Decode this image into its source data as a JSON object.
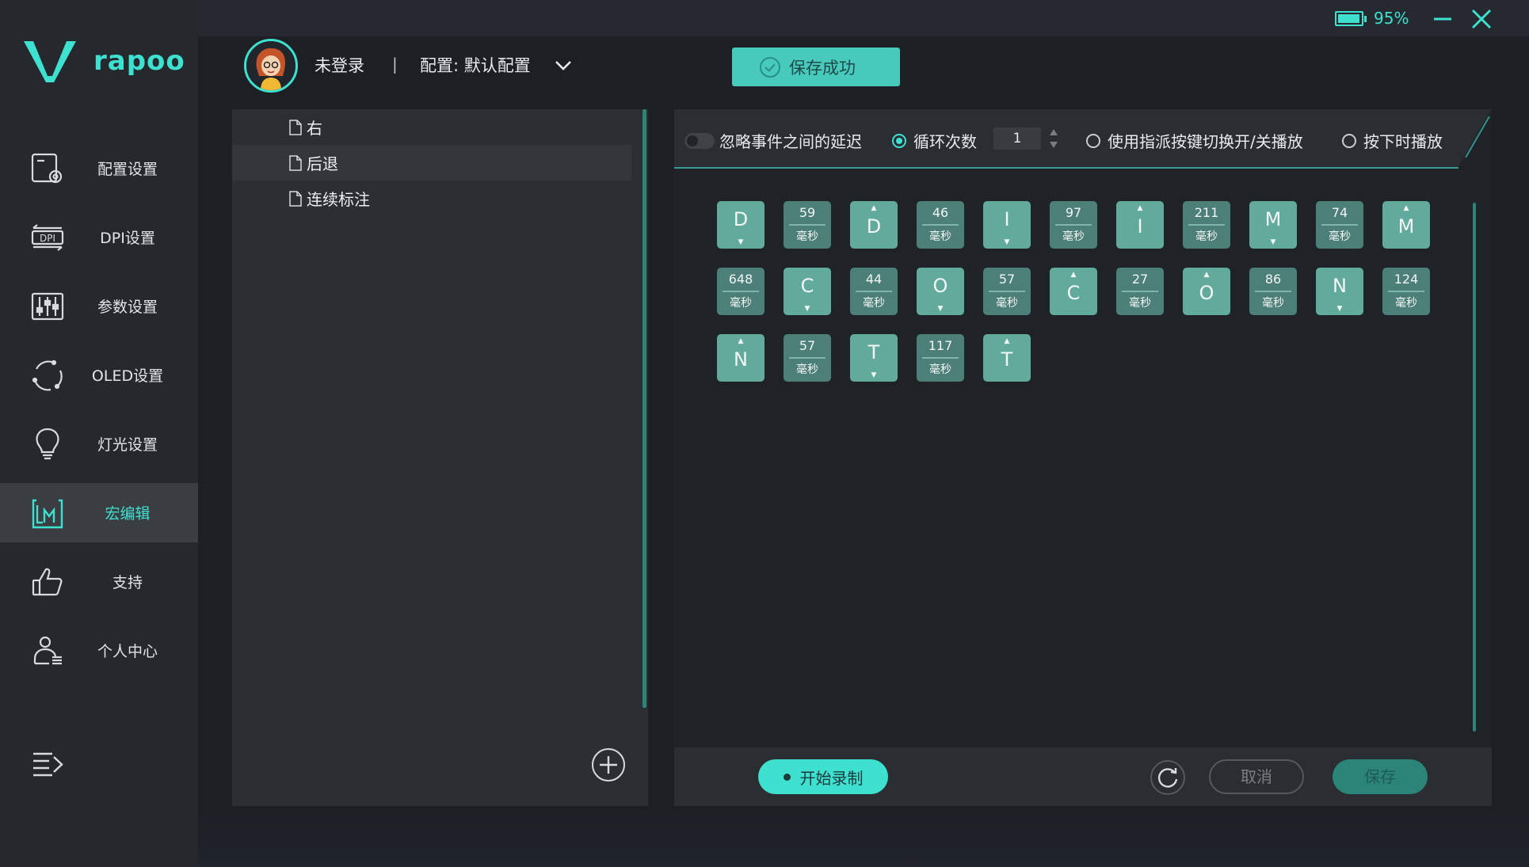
{
  "window": {
    "battery_percent": "95%",
    "battery_level": 0.95
  },
  "brand": {
    "name": "rapoo"
  },
  "sidebar": {
    "items": [
      {
        "label": "配置设置",
        "icon": "profile-settings-icon",
        "active": false
      },
      {
        "label": "DPI设置",
        "icon": "dpi-icon",
        "active": false
      },
      {
        "label": "参数设置",
        "icon": "sliders-icon",
        "active": false
      },
      {
        "label": "OLED设置",
        "icon": "oled-icon",
        "active": false
      },
      {
        "label": "灯光设置",
        "icon": "lightbulb-icon",
        "active": false
      },
      {
        "label": "宏编辑",
        "icon": "macro-icon",
        "active": true
      },
      {
        "label": "支持",
        "icon": "thumbs-up-icon",
        "active": false
      },
      {
        "label": "个人中心",
        "icon": "user-center-icon",
        "active": false
      }
    ]
  },
  "header": {
    "user": "未登录",
    "separator": "|",
    "config": "配置: 默认配置",
    "toast": "保存成功"
  },
  "macros": {
    "items": [
      {
        "name": "右",
        "highlighted": false
      },
      {
        "name": "后退",
        "highlighted": true
      },
      {
        "name": "连续标注",
        "highlighted": false
      }
    ]
  },
  "options": {
    "ignore_delay": "忽略事件之间的延迟",
    "loop_count": "循环次数",
    "loop_value": "1",
    "toggle_play": "使用指派按键切换开/关播放",
    "press_play": "按下时播放"
  },
  "keys": [
    [
      {
        "type": "down",
        "char": "D"
      },
      {
        "type": "delay",
        "value": "59",
        "unit": "毫秒"
      },
      {
        "type": "up",
        "char": "D"
      },
      {
        "type": "delay",
        "value": "46",
        "unit": "毫秒"
      },
      {
        "type": "down",
        "char": "I"
      },
      {
        "type": "delay",
        "value": "97",
        "unit": "毫秒"
      },
      {
        "type": "up",
        "char": "I"
      },
      {
        "type": "delay",
        "value": "211",
        "unit": "毫秒"
      },
      {
        "type": "down",
        "char": "M"
      },
      {
        "type": "delay",
        "value": "74",
        "unit": "毫秒"
      },
      {
        "type": "up",
        "char": "M"
      }
    ],
    [
      {
        "type": "delay",
        "value": "648",
        "unit": "毫秒"
      },
      {
        "type": "down",
        "char": "C"
      },
      {
        "type": "delay",
        "value": "44",
        "unit": "毫秒"
      },
      {
        "type": "down",
        "char": "O"
      },
      {
        "type": "delay",
        "value": "57",
        "unit": "毫秒"
      },
      {
        "type": "up",
        "char": "C"
      },
      {
        "type": "delay",
        "value": "27",
        "unit": "毫秒"
      },
      {
        "type": "up",
        "char": "O"
      },
      {
        "type": "delay",
        "value": "86",
        "unit": "毫秒"
      },
      {
        "type": "down",
        "char": "N"
      },
      {
        "type": "delay",
        "value": "124",
        "unit": "毫秒"
      }
    ],
    [
      {
        "type": "up",
        "char": "N"
      },
      {
        "type": "delay",
        "value": "57",
        "unit": "毫秒"
      },
      {
        "type": "down",
        "char": "T"
      },
      {
        "type": "delay",
        "value": "117",
        "unit": "毫秒"
      },
      {
        "type": "up",
        "char": "T"
      }
    ]
  ],
  "footer": {
    "record": "开始录制",
    "cancel": "取消",
    "save": "保存"
  },
  "colors": {
    "accent": "#3ee0d0",
    "key_fill": "#5fa799",
    "delay_fill": "#4b7f77",
    "sidebar_bg": "#25282d"
  }
}
